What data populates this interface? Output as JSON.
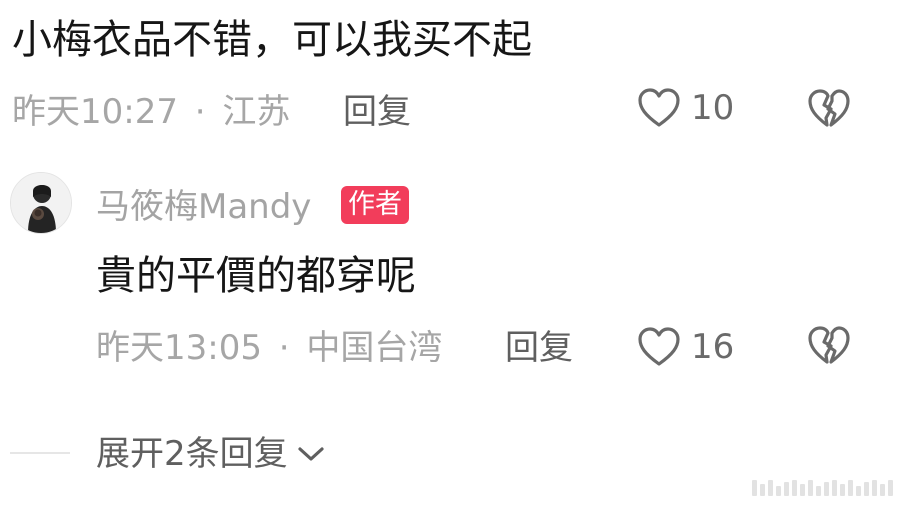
{
  "comment": {
    "text": "小梅衣品不错，可以我买不起",
    "time": "昨天10:27",
    "location": "江苏",
    "separator": "·",
    "reply_label": "回复",
    "like_count": "10"
  },
  "reply": {
    "author": "马筱梅Mandy",
    "badge": "作者",
    "text": "貴的平價的都穿呢",
    "time": "昨天13:05",
    "location": "中国台湾",
    "separator": "·",
    "reply_label": "回复",
    "like_count": "16"
  },
  "expand": {
    "label": "展开2条回复"
  },
  "icons": {
    "like": "heart-outline-icon",
    "dislike": "broken-heart-icon",
    "expand": "chevron-down-icon"
  },
  "colors": {
    "badge_bg": "#f23d5b",
    "meta_text": "#a6a6a6",
    "icon_gray": "#6a6a6a"
  }
}
